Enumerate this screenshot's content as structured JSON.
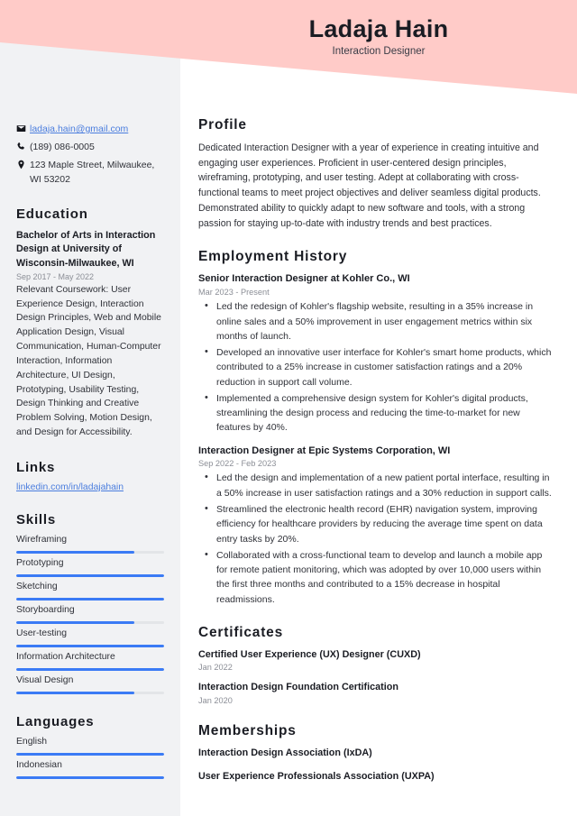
{
  "header": {
    "name": "Ladaja Hain",
    "job_title": "Interaction Designer",
    "banner_color": "#ffcbc8"
  },
  "sidebar": {
    "background_color": "#f1f2f4",
    "accent_color": "#3b7bf5",
    "contact": [
      {
        "icon": "envelope-icon",
        "text": "ladaja.hain@gmail.com",
        "is_link": true
      },
      {
        "icon": "phone-icon",
        "text": "(189) 086-0005",
        "is_link": false
      },
      {
        "icon": "location-pin-icon",
        "text": "123 Maple Street, Milwaukee, WI 53202",
        "is_link": false
      }
    ],
    "education": {
      "heading": "Education",
      "degree": "Bachelor of Arts in Interaction Design at University of Wisconsin-Milwaukee, WI",
      "date": "Sep 2017 - May 2022",
      "description": "Relevant Coursework: User Experience Design, Interaction Design Principles, Web and Mobile Application Design, Visual Communication, Human-Computer Interaction, Information Architecture, UI Design, Prototyping, Usability Testing, Design Thinking and Creative Problem Solving, Motion Design, and Design for Accessibility."
    },
    "links": {
      "heading": "Links",
      "items": [
        {
          "label": "linkedin.com/in/ladajahain"
        }
      ]
    },
    "skills": {
      "heading": "Skills",
      "items": [
        {
          "label": "Wireframing",
          "level": 80
        },
        {
          "label": "Prototyping",
          "level": 100
        },
        {
          "label": "Sketching",
          "level": 100
        },
        {
          "label": "Storyboarding",
          "level": 80
        },
        {
          "label": "User-testing",
          "level": 100
        },
        {
          "label": "Information Architecture",
          "level": 100
        },
        {
          "label": "Visual Design",
          "level": 80
        }
      ]
    },
    "languages": {
      "heading": "Languages",
      "items": [
        {
          "label": "English",
          "level": 100
        },
        {
          "label": "Indonesian",
          "level": 100
        }
      ]
    }
  },
  "main": {
    "profile": {
      "heading": "Profile",
      "text": "Dedicated Interaction Designer with a year of experience in creating intuitive and engaging user experiences. Proficient in user-centered design principles, wireframing, prototyping, and user testing. Adept at collaborating with cross-functional teams to meet project objectives and deliver seamless digital products. Demonstrated ability to quickly adapt to new software and tools, with a strong passion for staying up-to-date with industry trends and best practices."
    },
    "employment": {
      "heading": "Employment History",
      "jobs": [
        {
          "title": "Senior Interaction Designer at Kohler Co., WI",
          "date": "Mar 2023 - Present",
          "bullets": [
            "Led the redesign of Kohler's flagship website, resulting in a 35% increase in online sales and a 50% improvement in user engagement metrics within six months of launch.",
            "Developed an innovative user interface for Kohler's smart home products, which contributed to a 25% increase in customer satisfaction ratings and a 20% reduction in support call volume.",
            "Implemented a comprehensive design system for Kohler's digital products, streamlining the design process and reducing the time-to-market for new features by 40%."
          ]
        },
        {
          "title": "Interaction Designer at Epic Systems Corporation, WI",
          "date": "Sep 2022 - Feb 2023",
          "bullets": [
            "Led the design and implementation of a new patient portal interface, resulting in a 50% increase in user satisfaction ratings and a 30% reduction in support calls.",
            "Streamlined the electronic health record (EHR) navigation system, improving efficiency for healthcare providers by reducing the average time spent on data entry tasks by 20%.",
            "Collaborated with a cross-functional team to develop and launch a mobile app for remote patient monitoring, which was adopted by over 10,000 users within the first three months and contributed to a 15% decrease in hospital readmissions."
          ]
        }
      ]
    },
    "certificates": {
      "heading": "Certificates",
      "items": [
        {
          "name": "Certified User Experience (UX) Designer (CUXD)",
          "date": "Jan 2022"
        },
        {
          "name": "Interaction Design Foundation Certification",
          "date": "Jan 2020"
        }
      ]
    },
    "memberships": {
      "heading": "Memberships",
      "items": [
        {
          "name": "Interaction Design Association (IxDA)"
        },
        {
          "name": "User Experience Professionals Association (UXPA)"
        }
      ]
    }
  }
}
